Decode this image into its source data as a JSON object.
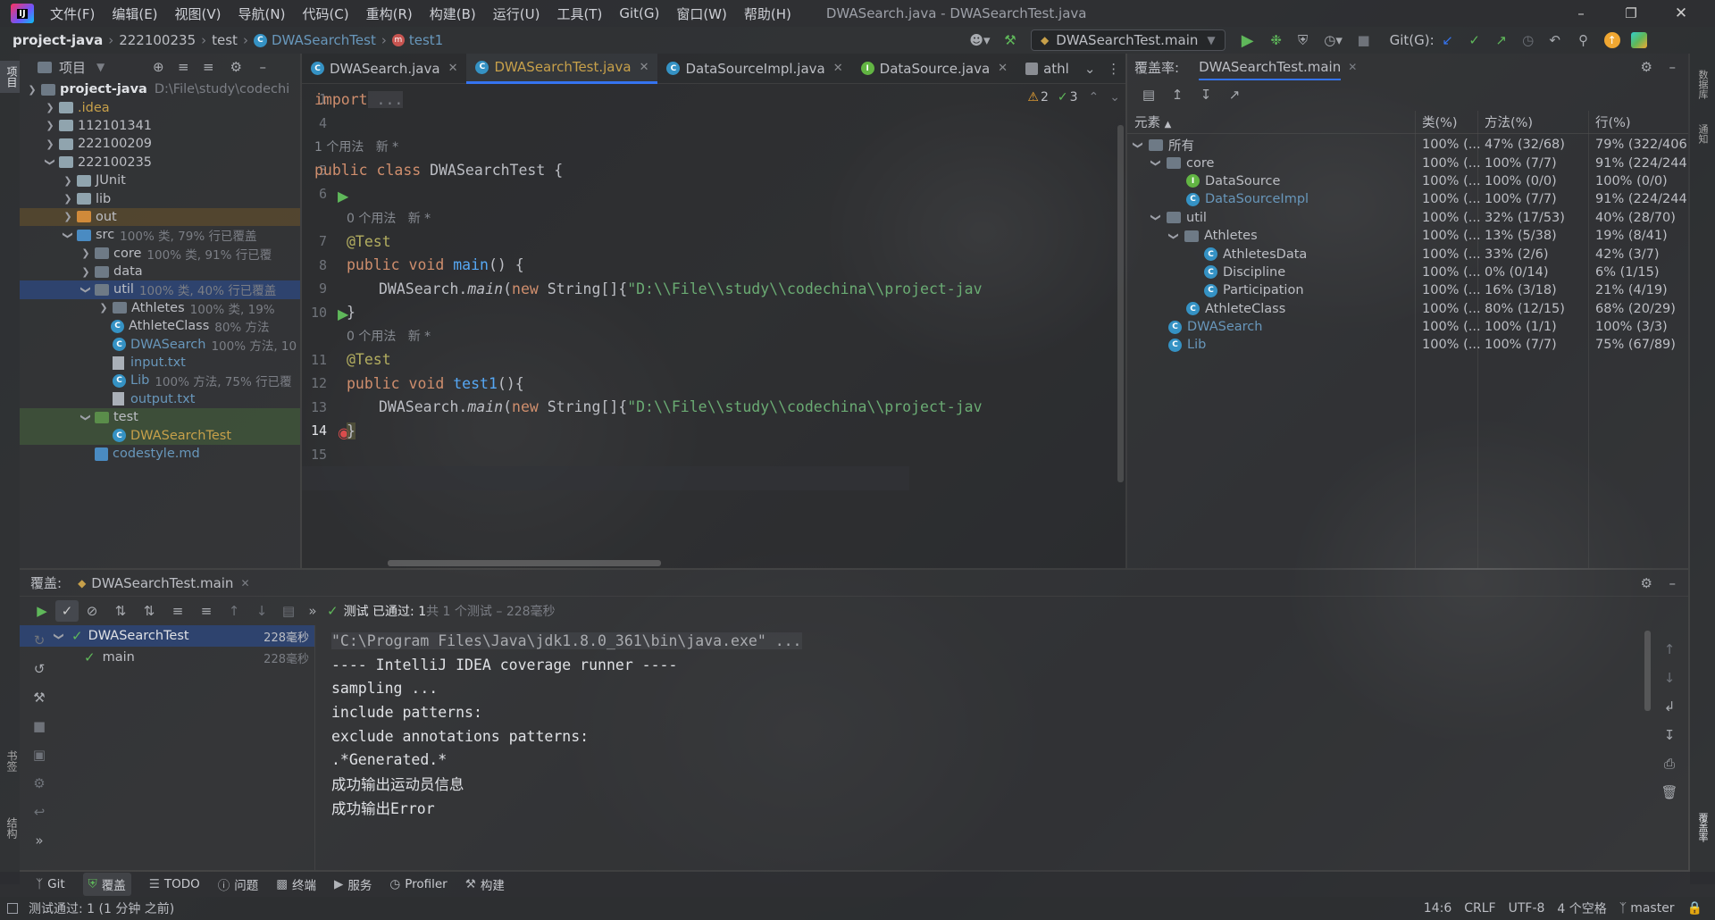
{
  "window": {
    "title": "DWASearch.java - DWASearchTest.java",
    "menu": [
      "文件(F)",
      "编辑(E)",
      "视图(V)",
      "导航(N)",
      "代码(C)",
      "重构(R)",
      "构建(B)",
      "运行(U)",
      "工具(T)",
      "Git(G)",
      "窗口(W)",
      "帮助(H)"
    ]
  },
  "breadcrumb": {
    "project": "project-java",
    "folder1": "222100235",
    "folder2": "test",
    "cls": "DWASearchTest",
    "method": "test1"
  },
  "toolbar": {
    "run_config": "DWASearchTest.main",
    "git_label": "Git(G):"
  },
  "project_panel": {
    "title": "项目",
    "root_name": "project-java",
    "root_path": "D:\\File\\study\\codechi",
    "items": [
      {
        "name": ".idea",
        "extra": ""
      },
      {
        "name": "112101341",
        "extra": ""
      },
      {
        "name": "222100209",
        "extra": ""
      },
      {
        "name": "222100235",
        "extra": ""
      },
      {
        "name": "JUnit",
        "extra": ""
      },
      {
        "name": "lib",
        "extra": ""
      },
      {
        "name": "out",
        "extra": ""
      },
      {
        "name": "src",
        "extra": "100% 类, 79% 行已覆盖"
      },
      {
        "name": "core",
        "extra": "100% 类, 91% 行已覆"
      },
      {
        "name": "data",
        "extra": ""
      },
      {
        "name": "util",
        "extra": "100% 类, 40% 行已覆盖"
      },
      {
        "name": "Athletes",
        "extra": "100% 类, 19%"
      },
      {
        "name": "AthleteClass",
        "extra": "80% 方法"
      },
      {
        "name": "DWASearch",
        "extra": "100% 方法, 10"
      },
      {
        "name": "input.txt",
        "extra": ""
      },
      {
        "name": "Lib",
        "extra": "100% 方法, 75% 行已覆"
      },
      {
        "name": "output.txt",
        "extra": ""
      },
      {
        "name": "test",
        "extra": ""
      },
      {
        "name": "DWASearchTest",
        "extra": ""
      },
      {
        "name": "codestyle.md",
        "extra": ""
      }
    ]
  },
  "editor": {
    "tabs": [
      "DWASearch.java",
      "DWASearchTest.java",
      "DataSourceImpl.java",
      "DataSource.java",
      "athl"
    ],
    "warnings": "2",
    "checks": "3",
    "usage_hint_1": "1 个用法   新 *",
    "usage_hint_2": "0 个用法   新 *",
    "usage_hint_3": "0 个用法   新 *",
    "line_numbers": [
      "1",
      "4",
      "5",
      "6",
      "7",
      "8",
      "9",
      "10",
      "11",
      "12",
      "13",
      "14",
      "15"
    ],
    "code": {
      "import_kw": "import",
      "import_rest": " ...",
      "l5_a": "public class",
      "l5_b": " DWASearchTest {",
      "l7": "@Test",
      "l8_a": "public void",
      "l8_b": "main",
      "l8_c": "() {",
      "l9_a": "DWASearch.",
      "l9_b": "main",
      "l9_c": "(",
      "l9_d": "new",
      "l9_e": " String[]{",
      "l9_f": "\"D:\\\\File\\\\study\\\\codechina\\\\project-jav",
      "l10": "}",
      "l11": "@Test",
      "l12_a": "public void",
      "l12_b": "test1",
      "l12_c": "(){",
      "l13_a": "DWASearch.",
      "l13_b": "main",
      "l13_c": "(",
      "l13_d": "new",
      "l13_e": " String[]{",
      "l13_f": "\"D:\\\\File\\\\study\\\\codechina\\\\project-jav",
      "l14": "}"
    }
  },
  "coverage_panel": {
    "label": "覆盖率:",
    "tab": "DWASearchTest.main",
    "headers": [
      "元素",
      "类(%)",
      "方法(%)",
      "行(%)"
    ],
    "rows": [
      {
        "name": "所有",
        "cls": "100% (...",
        "method": "47% (32/68)",
        "line": "79% (322/406)"
      },
      {
        "name": "core",
        "cls": "100% (...",
        "method": "100% (7/7)",
        "line": "91% (224/244)"
      },
      {
        "name": "DataSource",
        "cls": "100% (...",
        "method": "100% (0/0)",
        "line": "100% (0/0)"
      },
      {
        "name": "DataSourceImpl",
        "cls": "100% (...",
        "method": "100% (7/7)",
        "line": "91% (224/244)"
      },
      {
        "name": "util",
        "cls": "100% (...",
        "method": "32% (17/53)",
        "line": "40% (28/70)"
      },
      {
        "name": "Athletes",
        "cls": "100% (...",
        "method": "13% (5/38)",
        "line": "19% (8/41)"
      },
      {
        "name": "AthletesData",
        "cls": "100% (...",
        "method": "33% (2/6)",
        "line": "42% (3/7)"
      },
      {
        "name": "Discipline",
        "cls": "100% (...",
        "method": "0% (0/14)",
        "line": "6% (1/15)"
      },
      {
        "name": "Participation",
        "cls": "100% (...",
        "method": "16% (3/18)",
        "line": "21% (4/19)"
      },
      {
        "name": "AthleteClass",
        "cls": "100% (...",
        "method": "80% (12/15)",
        "line": "68% (20/29)"
      },
      {
        "name": "DWASearch",
        "cls": "100% (...",
        "method": "100% (1/1)",
        "line": "100% (3/3)"
      },
      {
        "name": "Lib",
        "cls": "100% (...",
        "method": "100% (7/7)",
        "line": "75% (67/89)"
      }
    ]
  },
  "bottom_panel": {
    "label": "覆盖:",
    "tab": "DWASearchTest.main",
    "status_bold": "测试 已通过: 1",
    "status_rest": "共 1 个测试 – 228毫秒",
    "tests": [
      {
        "name": "DWASearchTest",
        "time": "228毫秒"
      },
      {
        "name": "main",
        "time": "228毫秒"
      }
    ],
    "console": [
      "\"C:\\Program Files\\Java\\jdk1.8.0_361\\bin\\java.exe\" ...",
      "---- IntelliJ IDEA coverage runner ----",
      "sampling ...",
      "include patterns:",
      "exclude annotations patterns:",
      ".*Generated.*",
      "成功输出运动员信息",
      "成功输出Error"
    ]
  },
  "tool_strip": {
    "items": [
      "Git",
      "覆盖",
      "TODO",
      "问题",
      "终端",
      "服务",
      "Profiler",
      "构建"
    ]
  },
  "side_labels": {
    "left_top": "项目",
    "left_bottom_1": "书签",
    "left_bottom_2": "结构",
    "right_top_1": "数据库",
    "right_top_2": "通知",
    "right_bottom": "覆盖率"
  },
  "status_bar": {
    "message": "测试通过: 1 (1 分钟 之前)",
    "position": "14:6",
    "line_sep": "CRLF",
    "encoding": "UTF-8",
    "indent": "4 个空格",
    "branch": "master"
  },
  "colors": {
    "accent": "#3574f0",
    "selection": "#2e436e",
    "keyword": "#cf8e6d",
    "annotation": "#b3ae60",
    "function": "#56a8f5",
    "string": "#6aab73",
    "class_link": "#6897bb",
    "pass_green": "#5fb85a"
  }
}
